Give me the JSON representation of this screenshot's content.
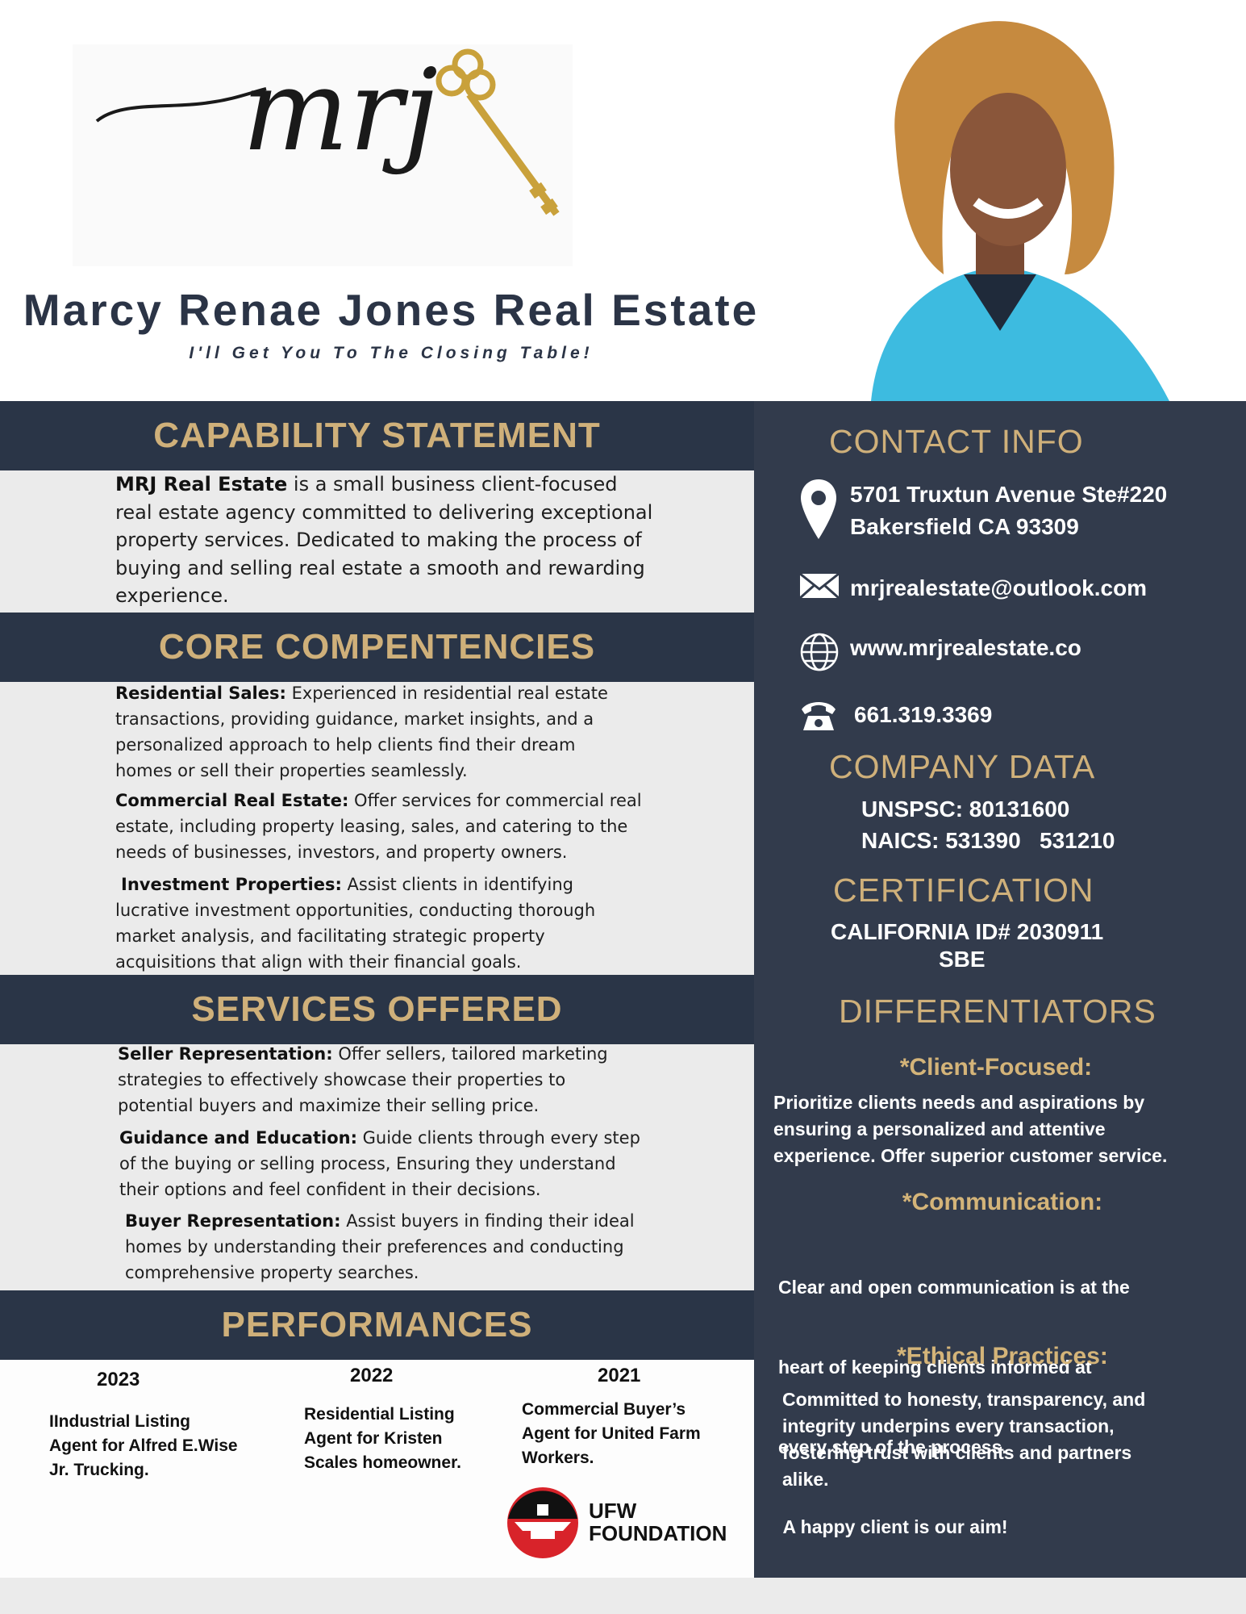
{
  "header": {
    "logo_text": "mrj",
    "business_name": "Marcy Renae Jones Real Estate",
    "tagline": "I'll Get You To The Closing Table!"
  },
  "capability": {
    "title": "CAPABILITY STATEMENT",
    "lead_bold": "MRJ Real Estate",
    "lines": [
      " is a  small business client-focused",
      "real estate agency committed to delivering exceptional",
      "property services. Dedicated to making the process of",
      "buying and selling real estate a smooth and rewarding",
      "experience."
    ]
  },
  "core": {
    "title": "CORE COMPENTENCIES",
    "items": [
      {
        "label": "Residential Sales:",
        "lines": [
          " Experienced in residential real estate",
          "transactions, providing guidance, market insights, and a",
          "personalized approach to help clients find their dream",
          "homes or sell their properties seamlessly."
        ]
      },
      {
        "label": "Commercial Real Estate:",
        "lines": [
          " Offer services for commercial real",
          "estate, including property leasing, sales, and catering to the",
          "needs of businesses, investors, and property owners."
        ]
      },
      {
        "label": "Investment Properties:",
        "lines": [
          " Assist clients in identifying",
          "lucrative investment opportunities, conducting thorough",
          "market analysis, and facilitating strategic property",
          "acquisitions that align with their financial goals."
        ]
      }
    ]
  },
  "services": {
    "title": "SERVICES OFFERED",
    "items": [
      {
        "label": "Seller Representation:",
        "lines": [
          " Offer sellers, tailored marketing",
          "strategies to effectively showcase their properties to",
          "potential buyers and maximize their selling price."
        ]
      },
      {
        "label": "Guidance and Education:",
        "lines": [
          " Guide clients through every step",
          "of the buying or selling process, Ensuring they understand",
          "their options and feel confident in their decisions."
        ]
      },
      {
        "label": "Buyer Representation:",
        "lines": [
          " Assist buyers in finding their ideal",
          "homes by understanding their preferences and conducting",
          "comprehensive property searches."
        ]
      }
    ]
  },
  "performances": {
    "title": "PERFORMANCES",
    "items": [
      {
        "year": "2023",
        "lines": [
          "IIndustrial Listing",
          "Agent for Alfred E.Wise",
          "Jr. Trucking."
        ]
      },
      {
        "year": "2022",
        "lines": [
          "Residential Listing",
          "Agent for Kristen",
          "Scales homeowner."
        ]
      },
      {
        "year": "2021",
        "lines": [
          "Commercial Buyer’s",
          "Agent for United Farm",
          "Workers."
        ]
      }
    ],
    "ufw_logo_line1": "UFW",
    "ufw_logo_line2": "FOUNDATION"
  },
  "contact": {
    "title": "CONTACT INFO",
    "address_line1": "5701 Truxtun Avenue Ste#220",
    "address_line2": "Bakersfield CA 93309",
    "email": "mrjrealestate@outlook.com",
    "website": "www.mrjrealestate.co",
    "phone": "661.319.3369"
  },
  "company": {
    "title": "COMPANY DATA",
    "unspsc": "UNSPSC: 80131600",
    "naics": "NAICS: 531390   531210"
  },
  "certification": {
    "title": "CERTIFICATION",
    "line1": "CALIFORNIA ID# 2030911",
    "line2": "SBE"
  },
  "differentiators": {
    "title": "DIFFERENTIATORS",
    "client_title": "*Client-Focused:",
    "client_lines": [
      "Prioritize clients needs and aspirations by",
      "ensuring a personalized and attentive",
      "experience. Offer superior customer service."
    ],
    "comm_title": "*Communication:",
    "comm_lines": [
      "Clear and open communication is at the",
      "heart of keeping clients informed at",
      "every step of the process.",
      " A happy client is our aim!"
    ],
    "ethics_title": "*Ethical Practices:",
    "ethics_lines": [
      "Committed to honesty, transparency, and",
      "integrity underpins every transaction,",
      "fostering trust with clients and partners",
      "alike."
    ]
  },
  "colors": {
    "navy_bar": "#2a3547",
    "right_panel": "#323b4c",
    "gold": "#cfb07a",
    "light_gray": "#ebebeb"
  }
}
